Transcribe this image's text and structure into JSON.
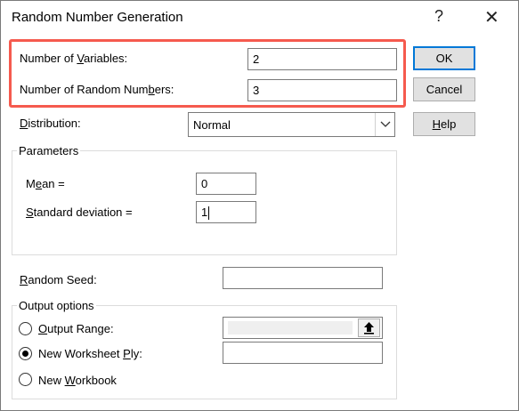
{
  "window": {
    "title": "Random Number Generation",
    "help_glyph": "?",
    "close_glyph": "✕"
  },
  "form": {
    "num_variables": {
      "label_pre": "Number of ",
      "label_u": "V",
      "label_post": "ariables:",
      "value": "2"
    },
    "num_random": {
      "label_pre": "Number of Random Num",
      "label_u": "b",
      "label_post": "ers:",
      "value": "3"
    },
    "distribution": {
      "label_u": "D",
      "label_post": "istribution:",
      "value": "Normal"
    }
  },
  "parameters": {
    "title": "Parameters",
    "mean": {
      "label_pre": "M",
      "label_u": "e",
      "label_post": "an =",
      "value": "0"
    },
    "stddev": {
      "label_u": "S",
      "label_post": "tandard deviation =",
      "value": "1"
    }
  },
  "random_seed": {
    "label_u": "R",
    "label_post": "andom Seed:",
    "value": ""
  },
  "output": {
    "title": "Output options",
    "output_range": {
      "label_u": "O",
      "label_post": "utput Range:",
      "selected": false,
      "value": ""
    },
    "new_ply": {
      "label_pre": "New Worksheet ",
      "label_u": "P",
      "label_post": "ly:",
      "selected": true,
      "value": ""
    },
    "new_workbook": {
      "label_pre": "New ",
      "label_u": "W",
      "label_post": "orkbook",
      "selected": false
    }
  },
  "buttons": {
    "ok": "OK",
    "cancel": "Cancel",
    "help_u": "H",
    "help_post": "elp"
  },
  "icons": {
    "dropdown": "chevron-down-icon",
    "collapse": "upload-arrow-icon"
  },
  "colors": {
    "highlight": "#f55a4e",
    "default_button_border": "#0078d7"
  }
}
